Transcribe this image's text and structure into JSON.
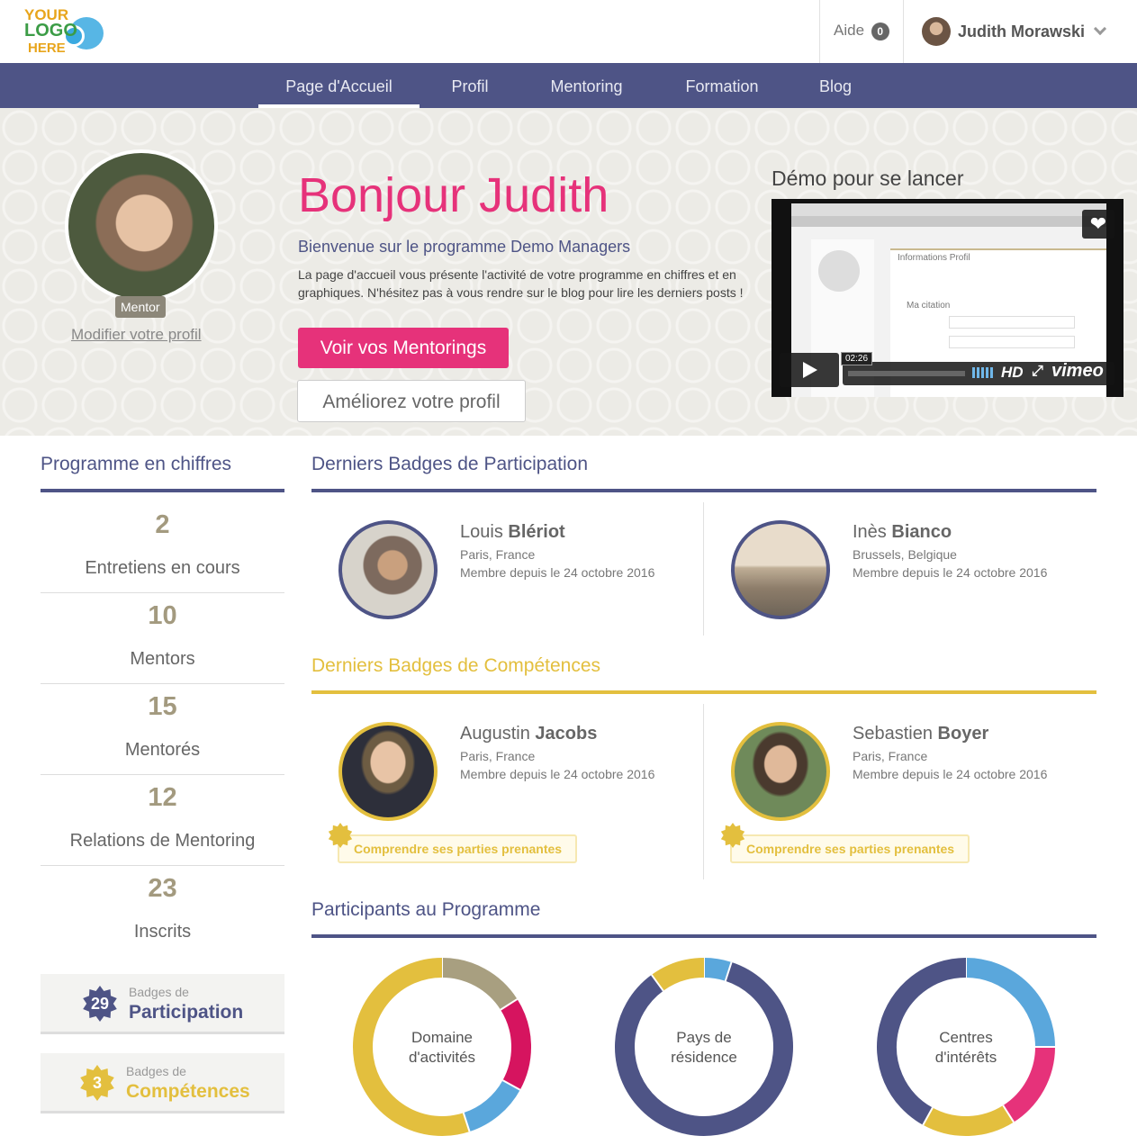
{
  "header": {
    "logo": {
      "line1": "YOUR",
      "line2": "LOGO",
      "line3": "HERE"
    },
    "help_label": "Aide",
    "help_count": "0",
    "user_name": "Judith Morawski"
  },
  "nav": {
    "items": [
      {
        "label": "Page d'Accueil",
        "active": true
      },
      {
        "label": "Profil",
        "active": false
      },
      {
        "label": "Mentoring",
        "active": false
      },
      {
        "label": "Formation",
        "active": false
      },
      {
        "label": "Blog",
        "active": false
      }
    ]
  },
  "hero": {
    "role_tag": "Mentor",
    "edit_profile_link": "Modifier votre profil",
    "greeting": "Bonjour Judith",
    "welcome": "Bienvenue sur le programme Demo Managers",
    "intro": "La page d'accueil vous présente l'activité de votre programme en chiffres et en graphiques. N'hésitez pas à vous rendre sur le blog pour lire les derniers posts !",
    "primary_button": "Voir vos Mentorings",
    "secondary_button": "Améliorez votre profil",
    "demo_title": "Démo pour se lancer",
    "video": {
      "duration": "02:26",
      "hd_label": "HD",
      "brand": "vimeo",
      "screen_heading": "Informations Profil",
      "screen_subheading": "Ma citation"
    }
  },
  "stats": {
    "title": "Programme en chiffres",
    "items": [
      {
        "value": "2",
        "label": "Entretiens en cours"
      },
      {
        "value": "10",
        "label": "Mentors"
      },
      {
        "value": "15",
        "label": "Mentorés"
      },
      {
        "value": "12",
        "label": "Relations de Mentoring"
      },
      {
        "value": "23",
        "label": "Inscrits"
      }
    ],
    "badges": [
      {
        "count": "29",
        "small": "Badges de",
        "big": "Participation",
        "color": "#4e5486"
      },
      {
        "count": "3",
        "small": "Badges de",
        "big": "Compétences",
        "color": "#e3bf3e"
      }
    ]
  },
  "participation": {
    "title": "Derniers Badges de Participation",
    "people": [
      {
        "first": "Louis",
        "last": "Blériot",
        "location": "Paris, France",
        "since": "Membre depuis le 24 octobre 2016"
      },
      {
        "first": "Inès",
        "last": "Bianco",
        "location": "Brussels, Belgique",
        "since": "Membre depuis le 24 octobre 2016"
      }
    ]
  },
  "competences": {
    "title": "Derniers Badges de Compétences",
    "people": [
      {
        "first": "Augustin",
        "last": "Jacobs",
        "location": "Paris, France",
        "since": "Membre depuis le 24 octobre 2016",
        "skill": "Comprendre ses parties prenantes"
      },
      {
        "first": "Sebastien",
        "last": "Boyer",
        "location": "Paris, France",
        "since": "Membre depuis le 24 octobre 2016",
        "skill": "Comprendre ses parties prenantes"
      }
    ]
  },
  "participants": {
    "title": "Participants au Programme",
    "charts": [
      {
        "label_line1": "Domaine",
        "label_line2": "d'activités"
      },
      {
        "label_line1": "Pays de",
        "label_line2": "résidence"
      },
      {
        "label_line1": "Centres",
        "label_line2": "d'intérêts"
      }
    ]
  },
  "colors": {
    "primary": "#4e5486",
    "accent_pink": "#e6327a",
    "gold": "#e3bf3e",
    "blue": "#5aa7dc",
    "taupe": "#a39a7f"
  },
  "chart_data": [
    {
      "type": "pie",
      "labels": [
        "taupe",
        "pink",
        "blue",
        "gold"
      ],
      "values": [
        16,
        17,
        12,
        55
      ],
      "colors": [
        "#a89f80",
        "#d6145f",
        "#5aa7dc",
        "#e3bf3e"
      ]
    },
    {
      "type": "pie",
      "labels": [
        "blue",
        "navy",
        "gold"
      ],
      "values": [
        5,
        85,
        10
      ],
      "colors": [
        "#5aa7dc",
        "#4e5486",
        "#e3bf3e"
      ]
    },
    {
      "type": "pie",
      "labels": [
        "blue",
        "pink",
        "gold",
        "navy"
      ],
      "values": [
        25,
        16,
        17,
        42
      ],
      "colors": [
        "#5aa7dc",
        "#e6327a",
        "#e3bf3e",
        "#4e5486"
      ]
    }
  ]
}
